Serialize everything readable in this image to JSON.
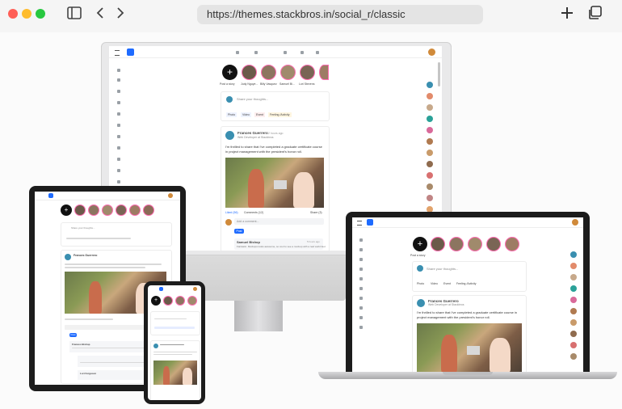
{
  "browser": {
    "url": "https://themes.stackbros.in/social_r/classic",
    "colors": {
      "close": "#ff5f57",
      "minimize": "#febc2e",
      "maximize": "#28c840"
    },
    "icons": [
      "sidebar-icon",
      "back-icon",
      "forward-icon",
      "new-tab-icon",
      "tabs-icon"
    ]
  },
  "app": {
    "stories": {
      "add_label": "Post a story",
      "names": [
        "Judy Nguye...",
        "Billy Vasquez",
        "Samuel Bi...",
        "Lori Stevens",
        "Joan Wall..."
      ]
    },
    "composer": {
      "placeholder": "Share your thoughts...",
      "actions": [
        "Photo",
        "Video",
        "Event",
        "Feeling /Activity"
      ]
    },
    "post": {
      "author": "Frances Guerrero",
      "time": "2 hours ago",
      "role": "Web Developer at Stackbros",
      "text": "I'm thrilled to share that I've completed a graduate certificate course in project management with the president's honor roll.",
      "liked": "Liked (56)",
      "comments": "Comments (12)",
      "share": "Share (3)",
      "comment_placeholder": "Add a comment...",
      "post_button": "Post"
    },
    "comment": {
      "author": "Samuel Bishop",
      "time": "5 hours ago",
      "text": "Fantastic. Mockups looks awesome, so cool to see a mockup with a real world feel."
    },
    "nested": {
      "author": "Frances Bishop",
      "author2": "Lori Ferguson",
      "like": "Like (3)",
      "reply": "Reply"
    },
    "accent": "#1e6bff"
  }
}
